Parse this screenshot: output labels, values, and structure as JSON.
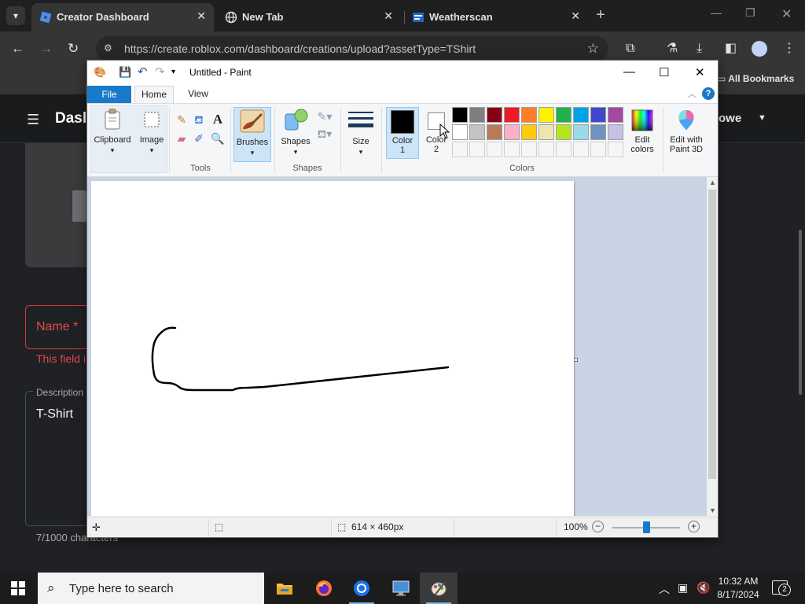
{
  "browser": {
    "tabs": [
      {
        "title": "Creator Dashboard",
        "favicon": "roblox-icon",
        "active": true
      },
      {
        "title": "New Tab",
        "favicon": "globe-icon",
        "active": false
      },
      {
        "title": "Weatherscan",
        "favicon": "weatherscan-icon",
        "active": false
      }
    ],
    "url": "https://create.roblox.com/dashboard/creations/upload?assetType=TShirt",
    "bookmarks_label": "All Bookmarks"
  },
  "webpage": {
    "title_partial": "Dasl",
    "user_partial": "owe",
    "name_label": "Name *",
    "name_error_partial": "This field i",
    "description_label": "Description",
    "description_value": "T-Shirt",
    "char_count": "7/1000 characters"
  },
  "paint": {
    "window_title": "Untitled - Paint",
    "ribbon_tabs": [
      "File",
      "Home",
      "View"
    ],
    "groups": {
      "clipboard": "Clipboard",
      "image": "Image",
      "tools": "Tools",
      "brushes": "Brushes",
      "shapes_btn": "Shapes",
      "shapes_group": "Shapes",
      "size": "Size",
      "color1": "Color\n1",
      "color2": "Color\n2",
      "colors_group": "Colors",
      "edit_colors": "Edit\ncolors",
      "edit_paint3d": "Edit with\nPaint 3D"
    },
    "palette_row1": [
      "#000000",
      "#7f7f7f",
      "#880015",
      "#ed1c24",
      "#ff7f27",
      "#fff200",
      "#22b14c",
      "#00a2e8",
      "#3f48cc",
      "#a349a4"
    ],
    "palette_row2": [
      "#ffffff",
      "#c3c3c3",
      "#b97a57",
      "#ffaec9",
      "#ffc90e",
      "#efe4b0",
      "#b5e61d",
      "#99d9ea",
      "#7092be",
      "#c8bfe7"
    ],
    "color1": "#000000",
    "color2": "#ffffff",
    "status": {
      "image_size": "614 × 460px",
      "zoom": "100%",
      "zoom_fraction": 0.5
    }
  },
  "taskbar": {
    "search_placeholder": "Type here to search",
    "time": "10:32 AM",
    "date": "8/17/2024",
    "notification_count": "2"
  }
}
